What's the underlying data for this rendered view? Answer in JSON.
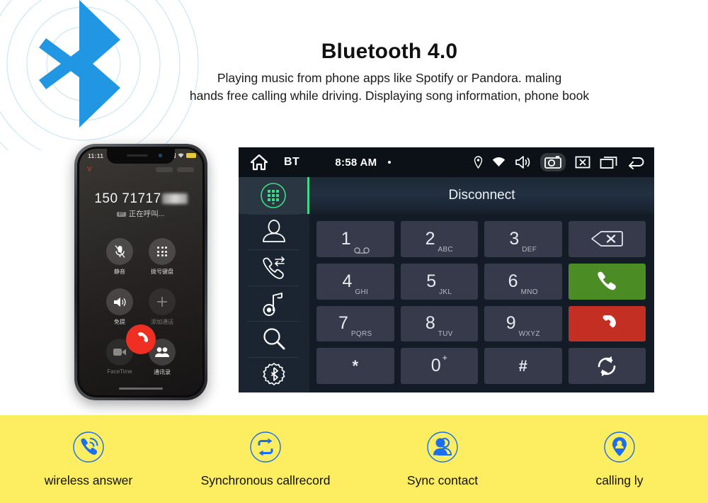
{
  "header": {
    "title": "Bluetooth 4.0",
    "subtitle_line1": "Playing music from phone apps like Spotify or Pandora. maling",
    "subtitle_line2": "hands free calling while driving. Displaying  song information, phone book",
    "logo_icon": "bluetooth-logo-icon",
    "logo_color": "#2196e3"
  },
  "phone": {
    "status": {
      "time": "11:11",
      "battery_color": "#e6c93c",
      "carrier_mark": "V"
    },
    "call": {
      "number": "150 71717",
      "status_text": "正在呼叫...",
      "bt_tag": "BT"
    },
    "buttons": [
      {
        "label": "静音",
        "icon": "mute-icon",
        "enabled": true
      },
      {
        "label": "拨号键盘",
        "icon": "keypad-icon",
        "enabled": true
      },
      {
        "label": "免提",
        "icon": "speaker-icon",
        "enabled": true
      },
      {
        "label": "添加通话",
        "icon": "add-call-icon",
        "enabled": false
      },
      {
        "label": "FaceTime",
        "icon": "facetime-icon",
        "enabled": false
      },
      {
        "label": "通讯录",
        "icon": "contacts-icon",
        "enabled": true
      }
    ],
    "end_call": {
      "icon": "end-call-icon",
      "color": "#f02f23"
    }
  },
  "headunit": {
    "statusbar": {
      "home_icon": "home-icon",
      "source_label": "BT",
      "time": "8:58 AM",
      "icons": [
        "location-icon",
        "wifi-icon",
        "volume-icon",
        "camera-icon",
        "close-icon",
        "recents-icon",
        "back-icon"
      ],
      "active_icon": "camera-icon"
    },
    "sidebar": [
      {
        "name": "keypad",
        "icon": "keypad-circle-icon",
        "selected": true
      },
      {
        "name": "contacts",
        "icon": "contact-icon",
        "selected": false
      },
      {
        "name": "calllog",
        "icon": "call-transfer-icon",
        "selected": false
      },
      {
        "name": "music",
        "icon": "music-note-icon",
        "selected": false
      },
      {
        "name": "search",
        "icon": "search-icon",
        "selected": false
      },
      {
        "name": "settings",
        "icon": "bluetooth-gear-icon",
        "selected": false
      }
    ],
    "selected_accent": "#3ddc84",
    "title": "Disconnect",
    "keys": [
      {
        "num": "1",
        "sub": "",
        "type": "digit"
      },
      {
        "num": "2",
        "sub": "ABC",
        "type": "digit"
      },
      {
        "num": "3",
        "sub": "DEF",
        "type": "digit"
      },
      {
        "num": "",
        "sub": "",
        "type": "action",
        "icon": "backspace-icon"
      },
      {
        "num": "4",
        "sub": "GHI",
        "type": "digit"
      },
      {
        "num": "5",
        "sub": "JKL",
        "type": "digit"
      },
      {
        "num": "6",
        "sub": "MNO",
        "type": "digit"
      },
      {
        "num": "",
        "sub": "",
        "type": "call",
        "icon": "call-icon",
        "color": "#4c8c24"
      },
      {
        "num": "7",
        "sub": "PQRS",
        "type": "digit"
      },
      {
        "num": "8",
        "sub": "TUV",
        "type": "digit"
      },
      {
        "num": "9",
        "sub": "WXYZ",
        "type": "digit"
      },
      {
        "num": "",
        "sub": "",
        "type": "hangup",
        "icon": "hangup-icon",
        "color": "#c32f22"
      },
      {
        "num": "*",
        "sub": "",
        "type": "symbol"
      },
      {
        "num": "0",
        "sup": "+",
        "type": "digit"
      },
      {
        "num": "#",
        "sub": "",
        "type": "symbol"
      },
      {
        "num": "",
        "sub": "",
        "type": "action",
        "icon": "sync-icon"
      }
    ]
  },
  "features": {
    "background": "#fced61",
    "icon_color": "#1a6ff0",
    "items": [
      {
        "label": "wireless answer",
        "icon": "wireless-answer-icon"
      },
      {
        "label": "Synchronous callrecord",
        "icon": "sync-callrecord-icon"
      },
      {
        "label": "Sync contact",
        "icon": "sync-contact-icon"
      },
      {
        "label": "calling ly",
        "icon": "calling-location-icon"
      }
    ]
  }
}
